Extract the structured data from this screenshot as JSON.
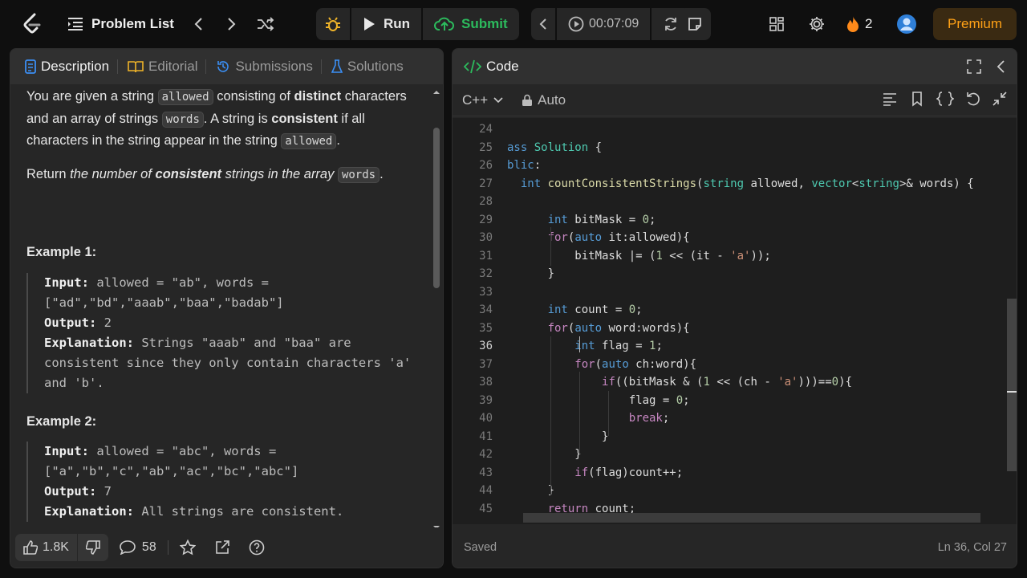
{
  "topbar": {
    "problem_list": "Problem List",
    "run": "Run",
    "submit": "Submit",
    "timer": "00:07:09",
    "streak": "2",
    "premium": "Premium"
  },
  "left_tabs": [
    "Description",
    "Editorial",
    "Submissions",
    "Solutions"
  ],
  "description": {
    "p1_a": "You are given a string ",
    "p1_code1": "allowed",
    "p1_b": " consisting of ",
    "p1_bold1": "distinct",
    "p1_c": " characters and an array of strings ",
    "p1_code2": "words",
    "p1_d": ". A string is ",
    "p1_bold2": "consistent",
    "p1_e": " if all characters in the string appear in the string ",
    "p1_code3": "allowed",
    "p1_f": ".",
    "p2_a": "Return ",
    "p2_i1": "the number of ",
    "p2_bi": "consistent",
    "p2_i2": " strings in the array ",
    "p2_code": "words",
    "p2_f": "."
  },
  "examples": [
    {
      "heading": "Example 1:",
      "input_label": "Input:",
      "input": " allowed = \"ab\", words = [\"ad\",\"bd\",\"aaab\",\"baa\",\"badab\"]",
      "output_label": "Output:",
      "output": " 2",
      "expl_label": "Explanation:",
      "expl": " Strings \"aaab\" and \"baa\" are consistent since they only contain characters 'a' and 'b'."
    },
    {
      "heading": "Example 2:",
      "input_label": "Input:",
      "input": " allowed = \"abc\", words = [\"a\",\"b\",\"c\",\"ab\",\"ac\",\"bc\",\"abc\"]",
      "output_label": "Output:",
      "output": " 7",
      "expl_label": "Explanation:",
      "expl": " All strings are consistent."
    }
  ],
  "left_footer": {
    "likes": "1.8K",
    "comments": "58"
  },
  "code_panel": {
    "title": "Code",
    "language": "C++",
    "mode": "Auto",
    "status": "Saved",
    "cursor": "Ln 36, Col 27"
  },
  "line_numbers": [
    "24",
    "25",
    "26",
    "27",
    "28",
    "29",
    "30",
    "31",
    "32",
    "33",
    "34",
    "35",
    "36",
    "37",
    "38",
    "39",
    "40",
    "41",
    "42",
    "43",
    "44",
    "45"
  ],
  "current_line": "36",
  "code_lines": [
    "",
    "ass Solution {",
    "blic:",
    "  int countConsistentStrings(string allowed, vector<string>& words) {",
    "",
    "      int bitMask = 0;",
    "      for(auto it:allowed){",
    "          bitMask |= (1 << (it - 'a'));",
    "      }",
    "",
    "      int count = 0;",
    "      for(auto word:words){",
    "          int flag = 1;",
    "          for(auto ch:word){",
    "              if((bitMask & (1 << (ch - 'a')))==0){",
    "                  flag = 0;",
    "                  break;",
    "              }",
    "          }",
    "          if(flag)count++;",
    "      }",
    "      return count;"
  ]
}
